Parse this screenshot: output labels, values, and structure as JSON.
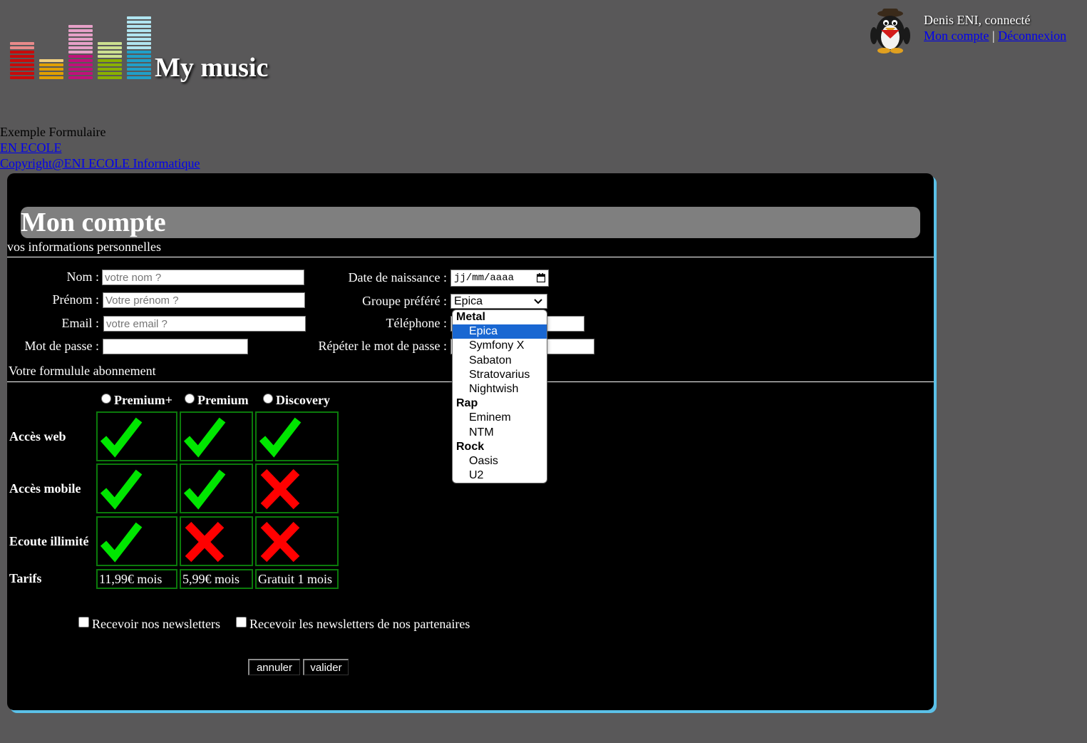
{
  "header": {
    "app_title": "My music",
    "user_name": "Denis ENI, connecté",
    "links": {
      "account": "Mon compte",
      "separator": "|",
      "logout": "Déconnexion"
    }
  },
  "nav": {
    "heading": "Exemple Formulaire",
    "link1": "EN ECOLE",
    "link2": "Copyright@ENI ECOLE Informatique"
  },
  "panel": {
    "title": "Mon compte",
    "personal_section": "vos informations personnelles",
    "subscription_section": "Votre formulule abonnement"
  },
  "form": {
    "nom": {
      "label": "Nom :",
      "placeholder": "votre nom ?"
    },
    "prenom": {
      "label": "Prénom :",
      "placeholder": "Votre prénom ?"
    },
    "email": {
      "label": "Email :",
      "placeholder": "votre email ?"
    },
    "password": {
      "label": "Mot de passe :"
    },
    "birthdate": {
      "label": "Date de naissance :",
      "value": "jj/mm/aaaa"
    },
    "group": {
      "label": "Groupe préféré :",
      "value": "Epica"
    },
    "phone": {
      "label": "Téléphone :"
    },
    "password_repeat": {
      "label": "Répéter le mot de passe :"
    }
  },
  "dropdown": {
    "groups": [
      {
        "label": "Metal",
        "options": [
          "Epica",
          "Symfony X",
          "Sabaton",
          "Stratovarius",
          "Nightwish"
        ]
      },
      {
        "label": "Rap",
        "options": [
          "Eminem",
          "NTM"
        ]
      },
      {
        "label": "Rock",
        "options": [
          "Oasis",
          "U2"
        ]
      }
    ],
    "selected": "Epica"
  },
  "plans": {
    "names": [
      "Premium+",
      "Premium",
      "Discovery"
    ],
    "features": [
      {
        "label": "Accès web",
        "values": [
          true,
          true,
          true
        ]
      },
      {
        "label": "Accès mobile",
        "values": [
          true,
          true,
          false
        ]
      },
      {
        "label": "Ecoute illimité",
        "values": [
          true,
          false,
          false
        ]
      }
    ],
    "tarifs_label": "Tarifs",
    "prices": [
      "11,99€ mois",
      "5,99€ mois",
      "Gratuit 1 mois"
    ]
  },
  "newsletter": {
    "own": "Recevoir nos newsletters",
    "partners": "Recevoir les newsletters de nos partenaires"
  },
  "buttons": {
    "cancel": "annuler",
    "submit": "valider"
  },
  "colors": {
    "panel_bg": "#000000",
    "accent_shadow": "#5bc0e8",
    "check": "#00e600",
    "cross": "#ff0000"
  }
}
